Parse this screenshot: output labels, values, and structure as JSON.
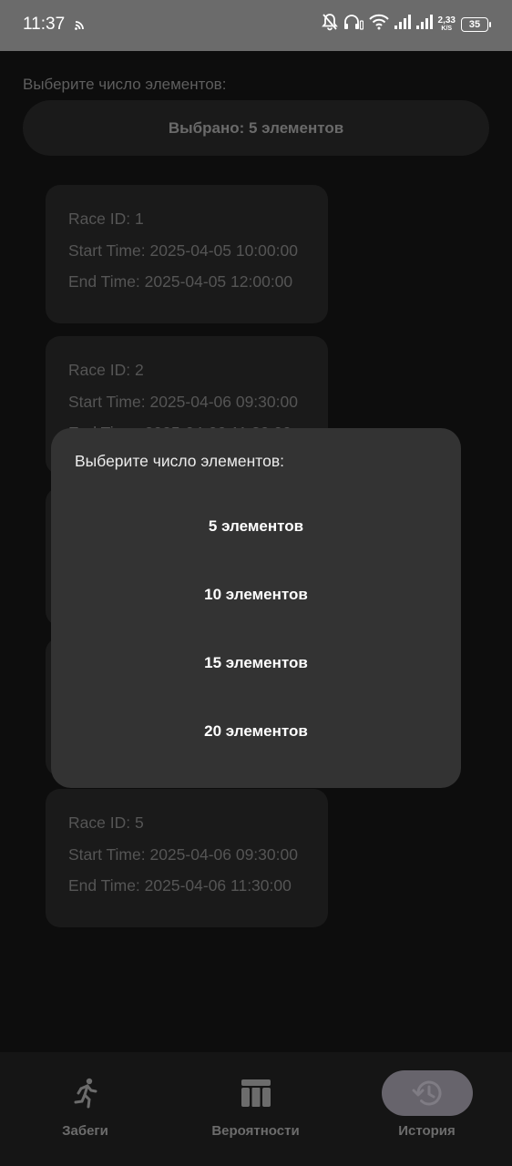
{
  "status_bar": {
    "time": "11:37",
    "speed_value": "2,33",
    "speed_unit": "K/S",
    "battery": "35"
  },
  "main": {
    "select_label": "Выберите число элементов:",
    "select_button": "Выбрано: 5 элементов",
    "races": [
      {
        "id": "Race ID: 1",
        "start": "Start Time: 2025-04-05 10:00:00",
        "end": "End Time: 2025-04-05 12:00:00"
      },
      {
        "id": "Race ID: 2",
        "start": "Start Time: 2025-04-06 09:30:00",
        "end": "End Time: 2025-04-06 11:30:00"
      },
      {
        "id": "Race ID: 5",
        "start": "Start Time: 2025-04-06 09:30:00",
        "end": "End Time: 2025-04-06 11:30:00"
      }
    ]
  },
  "dialog": {
    "title": "Выберите число элементов:",
    "options": [
      "5 элементов",
      "10 элементов",
      "15 элементов",
      "20 элементов"
    ]
  },
  "nav": {
    "items": [
      {
        "label": "Забеги",
        "icon": "running-icon"
      },
      {
        "label": "Вероятности",
        "icon": "table-icon"
      },
      {
        "label": "История",
        "icon": "history-icon"
      }
    ],
    "active_index": 2
  },
  "colors": {
    "background": "#0d0d0d",
    "dialog": "#333333",
    "active_indicator": "#67646c"
  }
}
